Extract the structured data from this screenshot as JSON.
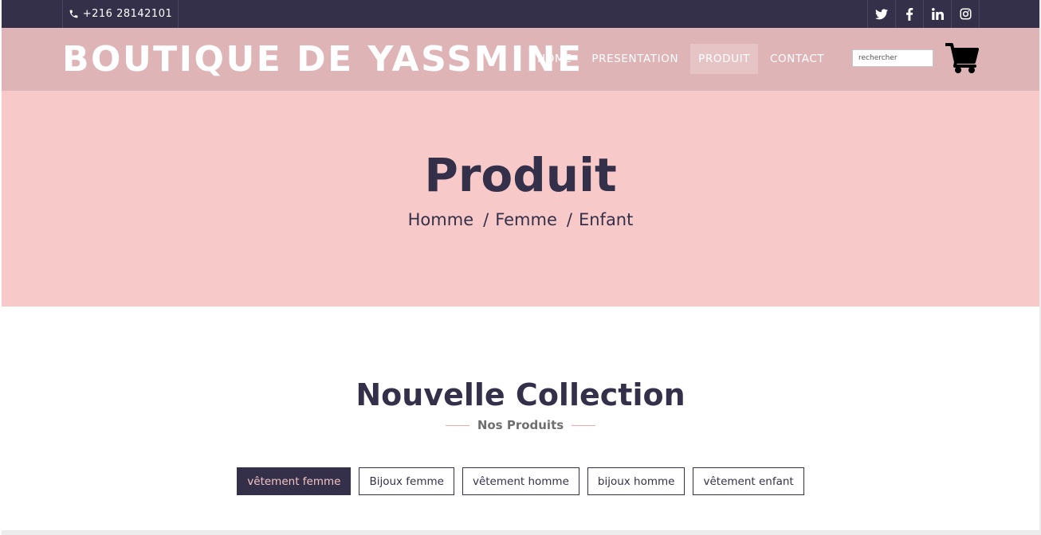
{
  "topbar": {
    "phone": "+216 28142101",
    "socials": [
      "twitter-icon",
      "facebook-icon",
      "linkedin-icon",
      "instagram-icon"
    ]
  },
  "header": {
    "brand": "BOUTIQUE DE YASSMINE",
    "menu": [
      {
        "label": "HOME"
      },
      {
        "label": "PRESENTATION"
      },
      {
        "label": "PRODUIT",
        "active": true
      },
      {
        "label": "CONTACT"
      }
    ],
    "search_placeholder": "rechercher",
    "cart_icon": "shopping-cart-icon"
  },
  "hero": {
    "title": "Produit",
    "breadcrumb": [
      "Homme",
      "Femme",
      "Enfant"
    ],
    "separator": "/"
  },
  "collection": {
    "title": "Nouvelle Collection",
    "subtitle": "Nos Produits",
    "filters": [
      {
        "label": "vêtement femme",
        "active": true
      },
      {
        "label": "Bijoux femme"
      },
      {
        "label": "vêtement homme"
      },
      {
        "label": "bijoux homme"
      },
      {
        "label": "vêtement enfant"
      }
    ]
  },
  "colors": {
    "dark": "#35304a",
    "nav_bg": "#deb4b6",
    "hero_bg": "#f7c9c9",
    "accent_line": "#f2a8ab"
  }
}
